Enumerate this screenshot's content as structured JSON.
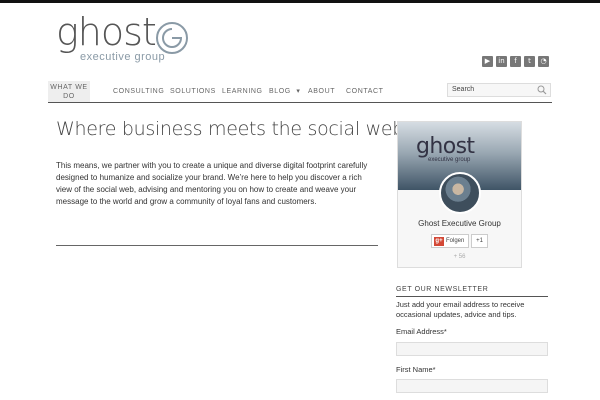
{
  "logo": {
    "word": "ghost",
    "subtitle": "executive group"
  },
  "social": [
    {
      "name": "youtube",
      "glyph": "▶"
    },
    {
      "name": "linkedin",
      "glyph": "in"
    },
    {
      "name": "facebook",
      "glyph": "f"
    },
    {
      "name": "twitter",
      "glyph": "t"
    },
    {
      "name": "rss",
      "glyph": "◔"
    }
  ],
  "nav": {
    "items": [
      {
        "label": "WHAT WE DO"
      },
      {
        "label": "CONSULTING"
      },
      {
        "label": "SOLUTIONS"
      },
      {
        "label": "LEARNING"
      },
      {
        "label": "BLOG"
      },
      {
        "label": "ABOUT"
      },
      {
        "label": "CONTACT"
      }
    ],
    "blog_caret": "▾",
    "search_placeholder": "Search"
  },
  "main": {
    "headline": "Where business meets the social web",
    "body": "This means, we partner with you to create a unique and diverse digital footprint carefully designed to humanize and socialize your brand. We’re here to help you discover a rich view of the social web, advising and mentoring you on how to create and weave your message to the world and grow a community of loyal fans and customers."
  },
  "profile": {
    "banner_word": "ghost",
    "banner_sub": "executive group",
    "name": "Ghost Executive Group",
    "follow_label": "Folgen",
    "gplus_glyph": "g+",
    "plusone_label": "+1",
    "count": "+ 56"
  },
  "newsletter": {
    "title": "GET OUR NEWSLETTER",
    "description": "Just add your email address to receive occasional updates, advice and tips.",
    "email_label": "Email Address*",
    "firstname_label": "First Name*"
  },
  "colors": {
    "accent": "#555555",
    "nav_active_bg": "#eeeeee",
    "gplus": "#d34836"
  }
}
